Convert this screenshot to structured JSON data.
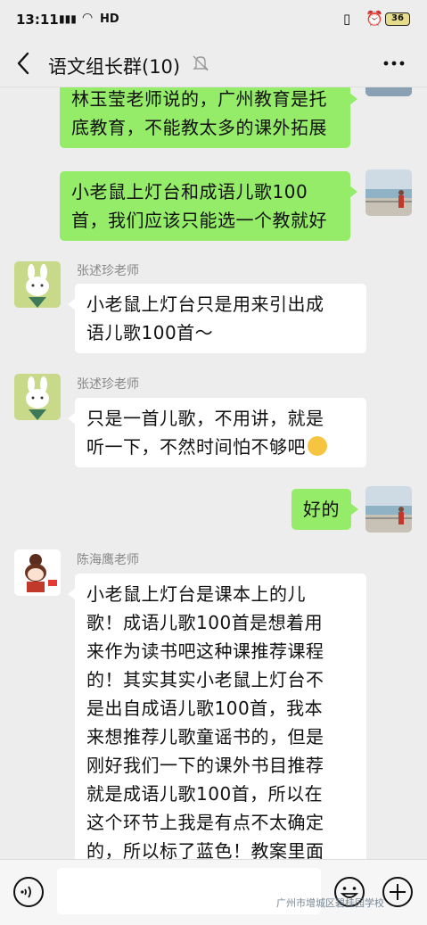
{
  "status_bar": {
    "time": "13:11",
    "network": "HD",
    "battery": "36"
  },
  "header": {
    "title": "语文组长群(10)"
  },
  "messages": [
    {
      "sender": "",
      "text_lines": [
        "林玉莹老师说的，广州教育是托",
        "底教育，不能教太多的课外拓展"
      ],
      "mine": true
    },
    {
      "sender": "",
      "text_lines": [
        "小老鼠上灯台和成语儿歌100",
        "首，我们应该只能选一个教就好"
      ],
      "mine": true
    },
    {
      "sender": "张述珍老师",
      "text_lines": [
        "小老鼠上灯台只是用来引出成",
        "语儿歌100首～"
      ],
      "mine": false
    },
    {
      "sender": "张述珍老师",
      "text_lines": [
        "只是一首儿歌，不用讲，就是",
        "听一下，不然时间怕不够吧"
      ],
      "mine": false
    },
    {
      "sender": "",
      "text_lines": [
        "好的"
      ],
      "mine": true
    },
    {
      "sender": "陈海鹰老师",
      "text_lines": [
        "小老鼠上灯台是课本上的儿",
        "歌！成语儿歌100首是想着用",
        "来作为读书吧这种课推荐课程",
        "的！其实其实小老鼠上灯台不",
        "是出自成语儿歌100首，我本",
        "来想推荐儿歌童谣书的，但是",
        "刚好我们一下的课外书目推荐",
        "就是成语儿歌100首，所以在",
        "这个环节上我是有点不太确定",
        "的，所以标了蓝色！教案里面"
      ],
      "mine": false
    }
  ],
  "input": {
    "value": ""
  },
  "watermark": "广州市增城区碧桂园学校",
  "colors": {
    "my_bubble": "#95ec69",
    "other_bubble": "#ffffff",
    "background": "#ededed"
  }
}
